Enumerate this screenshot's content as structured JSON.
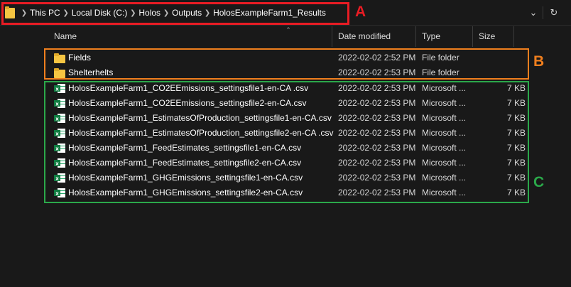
{
  "breadcrumb": [
    "This PC",
    "Local Disk (C:)",
    "Holos",
    "Outputs",
    "HolosExampleFarm1_Results"
  ],
  "address_controls": {
    "dropdown": "⌄",
    "refresh": "↻"
  },
  "columns": {
    "name": "Name",
    "date": "Date modified",
    "type": "Type",
    "size": "Size"
  },
  "folders": [
    {
      "name": "Fields",
      "date": "2022-02-02 2:52 PM",
      "type": "File folder",
      "size": ""
    },
    {
      "name": "Shelterhelts",
      "date": "2022-02-02 2:53 PM",
      "type": "File folder",
      "size": ""
    }
  ],
  "files": [
    {
      "name": "HolosExampleFarm1_CO2EEmissions_settingsfile1-en-CA .csv",
      "date": "2022-02-02 2:53 PM",
      "type": "Microsoft ...",
      "size": "7 KB"
    },
    {
      "name": "HolosExampleFarm1_CO2EEmissions_settingsfile2-en-CA.csv",
      "date": "2022-02-02 2:53 PM",
      "type": "Microsoft ...",
      "size": "7 KB"
    },
    {
      "name": "HolosExampleFarm1_EstimatesOfProduction_settingsfile1-en-CA.csv",
      "date": "2022-02-02 2:53 PM",
      "type": "Microsoft ...",
      "size": "7 KB"
    },
    {
      "name": "HolosExampleFarm1_EstimatesOfProduction_settingsfile2-en-CA .csv",
      "date": "2022-02-02 2:53 PM",
      "type": "Microsoft ...",
      "size": "7 KB"
    },
    {
      "name": "HolosExampleFarm1_FeedEstimates_settingsfile1-en-CA.csv",
      "date": "2022-02-02 2:53 PM",
      "type": "Microsoft ...",
      "size": "7 KB"
    },
    {
      "name": "HolosExampleFarm1_FeedEstimates_settingsfile2-en-CA.csv",
      "date": "2022-02-02 2:53 PM",
      "type": "Microsoft ...",
      "size": "7 KB"
    },
    {
      "name": "HolosExampleFarm1_GHGEmissions_settingsfile1-en-CA.csv",
      "date": "2022-02-02 2:53 PM",
      "type": "Microsoft ...",
      "size": "7 KB"
    },
    {
      "name": "HolosExampleFarm1_GHGEmissions_settingsfile2-en-CA.csv",
      "date": "2022-02-02 2:53 PM",
      "type": "Microsoft ...",
      "size": "7 KB"
    }
  ],
  "annotations": {
    "a": {
      "label": "A",
      "color": "#e81c24"
    },
    "b": {
      "label": "B",
      "color": "#f07f1e"
    },
    "c": {
      "label": "C",
      "color": "#2ba84a"
    }
  },
  "icons": {
    "folder": "folder-icon",
    "excel": "excel-csv-icon",
    "refresh": "refresh-icon",
    "dropdown": "chevron-down-icon"
  }
}
